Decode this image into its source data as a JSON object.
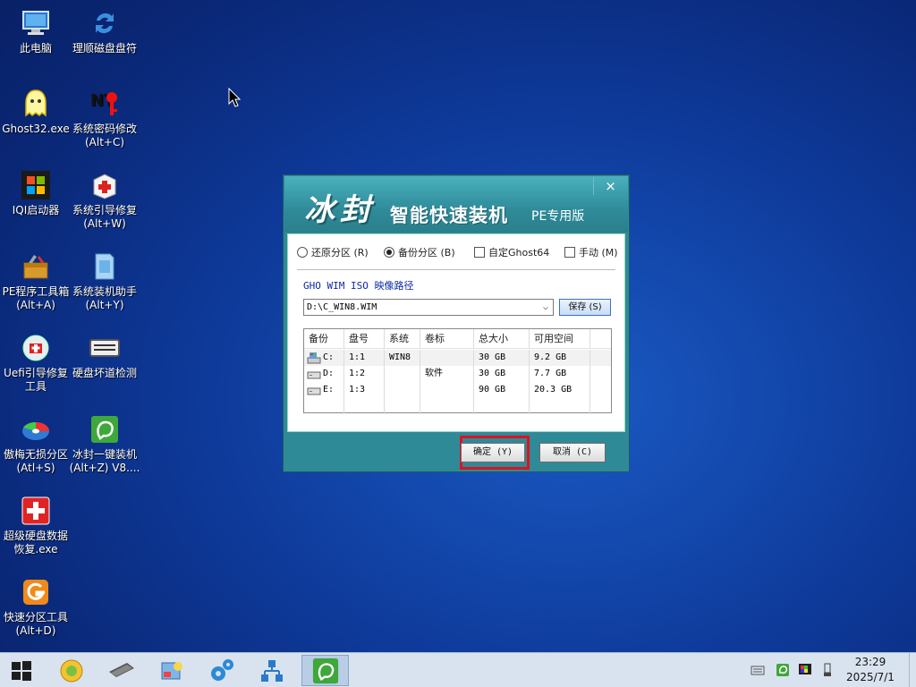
{
  "desktop": {
    "icons": [
      {
        "label": "此电脑"
      },
      {
        "label": "理顺磁盘盘符"
      },
      {
        "label": "Ghost32.exe"
      },
      {
        "label": "系统密码修改",
        "sub": "(Alt+C)"
      },
      {
        "label": "IQI启动器"
      },
      {
        "label": "系统引导修复",
        "sub": "(Alt+W)"
      },
      {
        "label": "PE程序工具箱",
        "sub": "(Alt+A)"
      },
      {
        "label": "系统装机助手",
        "sub": "(Alt+Y)"
      },
      {
        "label": "Uefi引导修复",
        "sub": "工具"
      },
      {
        "label": "硬盘坏道检测"
      },
      {
        "label": "傲梅无损分区",
        "sub": "(Atl+S)"
      },
      {
        "label": "冰封一键装机",
        "sub": "(Alt+Z) V8...."
      },
      {
        "label": "超级硬盘数据",
        "sub": "恢复.exe"
      },
      {
        "label": "快速分区工具",
        "sub": "(Alt+D)"
      }
    ]
  },
  "dialog": {
    "close_glyph": "×",
    "title_main": "冰封",
    "title_sub": "智能快速装机",
    "title_edition": "PE专用版",
    "options": {
      "restore": {
        "label": "还原分区 (R)",
        "selected": false
      },
      "backup": {
        "label": "备份分区 (B)",
        "selected": true
      },
      "custom_ghost": {
        "label": "自定Ghost64",
        "checked": false
      },
      "manual": {
        "label": "手动 (M)",
        "checked": false
      }
    },
    "path_label": "GHO WIM ISO 映像路径",
    "path_value": "D:\\C_WIN8.WIM",
    "save_label": "保存 (S)",
    "table": {
      "headers": [
        "备份",
        "盘号",
        "系统",
        "卷标",
        "总大小",
        "可用空间",
        ""
      ],
      "rows": [
        {
          "drive": "C:",
          "num": "1:1",
          "system": "WIN8",
          "volume": "",
          "total": "30 GB",
          "free": "9.2 GB"
        },
        {
          "drive": "D:",
          "num": "1:2",
          "system": "",
          "volume": "软件",
          "total": "30 GB",
          "free": "7.7 GB"
        },
        {
          "drive": "E:",
          "num": "1:3",
          "system": "",
          "volume": "",
          "total": "90 GB",
          "free": "20.3 GB"
        }
      ]
    },
    "ok_label": "确定 (Y)",
    "cancel_label": "取消 (C)"
  },
  "taskbar": {
    "time": "23:29",
    "date": "2025/7/1"
  }
}
